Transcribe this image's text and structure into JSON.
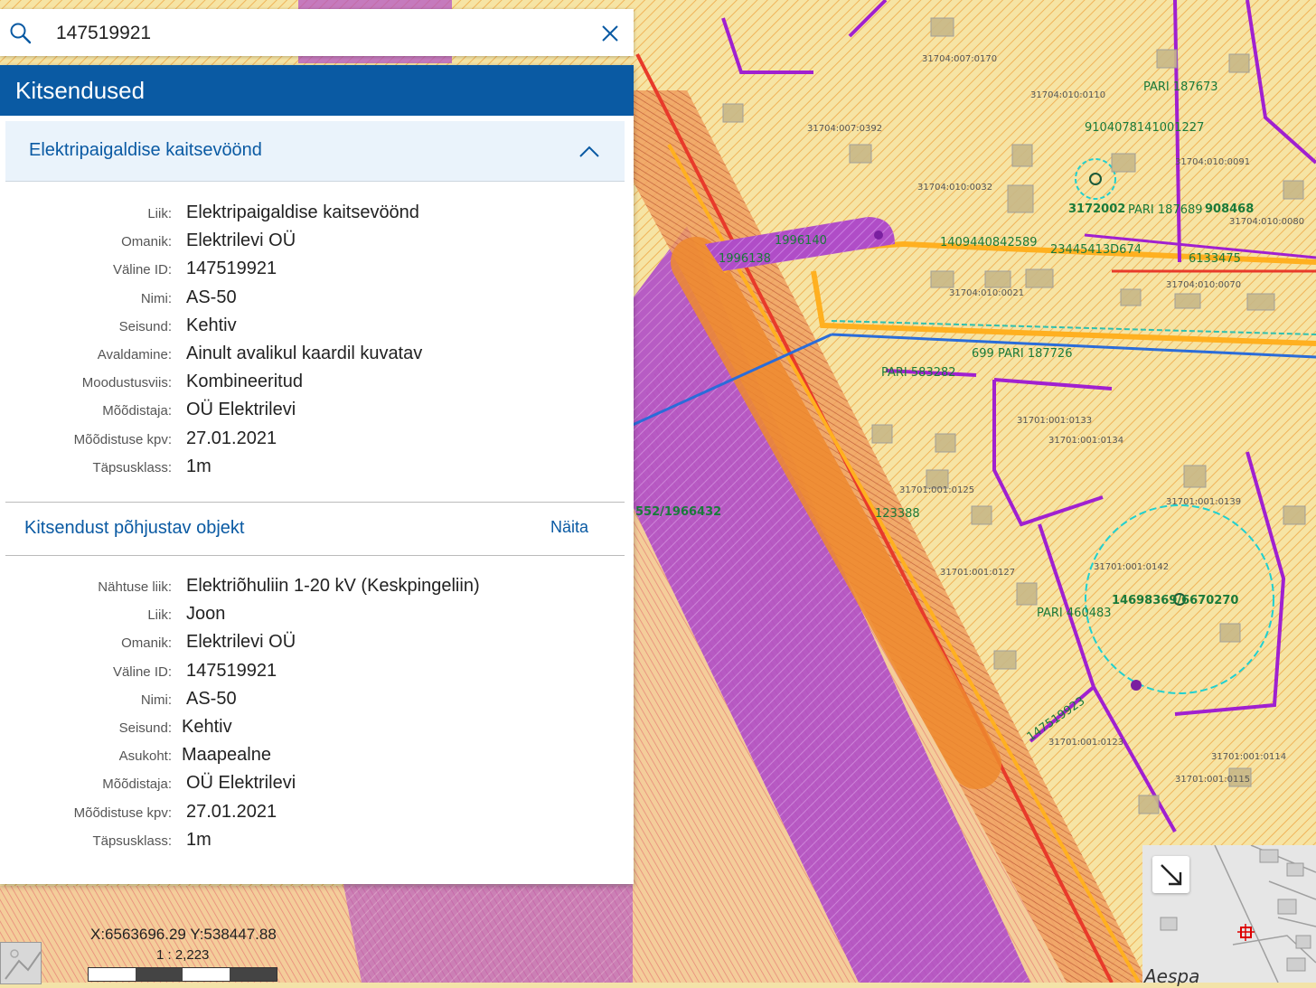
{
  "search": {
    "query": "147519921"
  },
  "panel": {
    "title": "Kitsendused",
    "section1": {
      "title": "Elektripaigaldise kaitsevöönd",
      "rows": [
        {
          "label": "Liik:",
          "value": "Elektripaigaldise kaitsevöönd"
        },
        {
          "label": "Omanik:",
          "value": "Elektrilevi OÜ"
        },
        {
          "label": "Väline ID:",
          "value": "147519921"
        },
        {
          "label": "Nimi:",
          "value": "AS-50"
        },
        {
          "label": "Seisund:",
          "value": "Kehtiv"
        },
        {
          "label": "Avaldamine:",
          "value": "Ainult avalikul kaardil kuvatav"
        },
        {
          "label": "Moodustusviis:",
          "value": "Kombineeritud"
        },
        {
          "label": "Mõõdistaja:",
          "value": "OÜ Elektrilevi"
        },
        {
          "label": "Mõõdistuse kpv:",
          "value": "27.01.2021"
        },
        {
          "label": "Täpsusklass:",
          "value": "1m"
        }
      ]
    },
    "section2": {
      "title": "Kitsendust põhjustav objekt",
      "show_label": "Näita",
      "rows": [
        {
          "label": "Nähtuse liik:",
          "value": "Elektriõhuliin 1-20 kV (Keskpingeliin)"
        },
        {
          "label": "Liik:",
          "value": "Joon"
        },
        {
          "label": "Omanik:",
          "value": "Elektrilevi OÜ"
        },
        {
          "label": "Väline ID:",
          "value": "147519921"
        },
        {
          "label": "Nimi:",
          "value": "AS-50"
        },
        {
          "label": "Seisund:",
          "value": "Kehtiv"
        },
        {
          "label": "Asukoht:",
          "value": "Maapealne"
        },
        {
          "label": "Mõõdistaja:",
          "value": "OÜ Elektrilevi"
        },
        {
          "label": "Mõõdistuse kpv:",
          "value": "27.01.2021"
        },
        {
          "label": "Täpsusklass:",
          "value": "1m"
        }
      ]
    }
  },
  "map": {
    "coordinates": "X:6563696.29 Y:538447.88",
    "scale": "1 : 2,223",
    "overview_label": "Aespa",
    "labels": {
      "l1": "172002",
      "l2": "3172002",
      "l3": "PARI 187689",
      "l4": "908468",
      "l5": "PARI 187673",
      "l6": "9104078141001227",
      "l7": "23445413D674",
      "l8": "6133475",
      "l9": "1409440842589",
      "l10": "1996138",
      "l11": "1996140",
      "l12": "699 PARI 187726",
      "l13": "PARI 583282",
      "l14": "123388",
      "l15": "552/1966432",
      "l16": "14698369/6670270",
      "l17": "PARI 460483",
      "l18": "147519923",
      "l19": "31701:001:0142",
      "l20": "31704:010:0091",
      "l21": "31704:010:0070",
      "l22": "31701:001:0125",
      "l23": "31701:001:0127",
      "l24": "31701:001:0114",
      "l25": "31704:010:0021",
      "l26": "31701:001:0139",
      "l27": "31704:007:0170",
      "l28": "31704:010:0110",
      "l29": "31704:010:0032",
      "l30": "31701:001:0123",
      "l31": "31701:001:0115",
      "l32": "31701:001:0134",
      "l33": "31704:007:0392",
      "l34": "31704:010:0080",
      "l35": "31701:001:0133"
    }
  },
  "colors": {
    "header": "#0a5aa3",
    "accent": "#0a5aa3",
    "purple_zone": "#a347c2",
    "orange_highlight": "#ef8a2e",
    "map_background": "#f3e3a8"
  }
}
